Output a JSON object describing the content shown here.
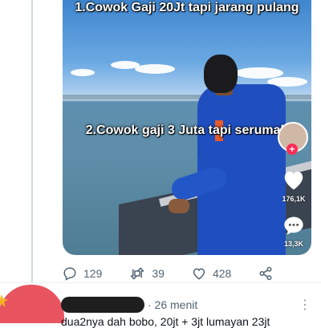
{
  "video": {
    "caption_1": "1.Cowok Gaji 20Jt tapi jarang pulang",
    "caption_2": "2.Cowok gaji 3 Juta tapi serumah",
    "sidebar": {
      "follow_symbol": "+",
      "like_count": "176,1K",
      "comment_count": "13,3K"
    }
  },
  "tweet_actions": {
    "reply_count": "129",
    "retweet_count": "39",
    "like_count": "428"
  },
  "reply": {
    "meta": "· 26 menit",
    "text": "dua2nya dah bobo, 20jt + 3jt lumayan 23jt"
  },
  "icons": {
    "reply": "speech-bubble-icon",
    "retweet": "retweet-icon",
    "like": "heart-outline-icon",
    "share": "share-icon",
    "more": "more-vertical-icon"
  },
  "colors": {
    "accent_red": "#fe2c55",
    "action_gray": "#536471",
    "uniform_blue": "#1f4fbf"
  }
}
